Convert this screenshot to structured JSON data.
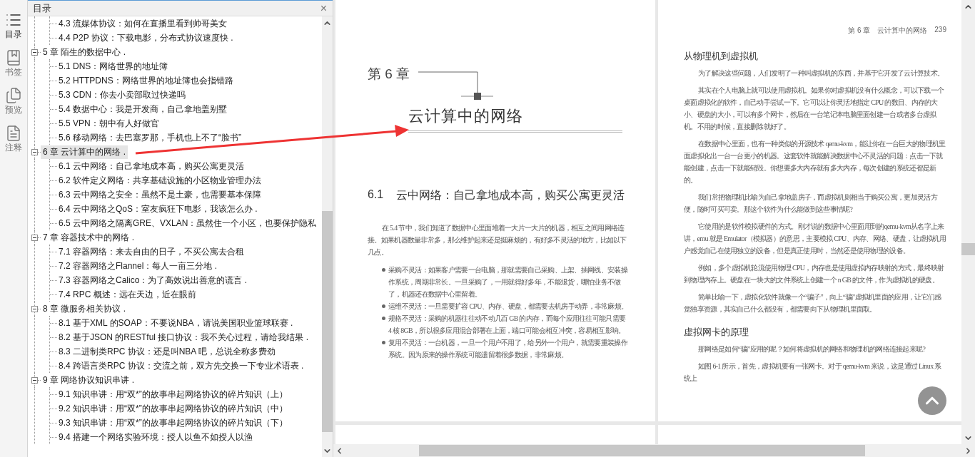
{
  "rail": [
    {
      "label": "目录",
      "selected": true
    },
    {
      "label": "书签",
      "selected": false
    },
    {
      "label": "预览",
      "selected": false
    },
    {
      "label": "注释",
      "selected": false
    }
  ],
  "toc": {
    "title": "目录",
    "close": "×",
    "tree": [
      {
        "children": [
          {
            "label": "4.3 流媒体协议：如何在直播里看到帅哥美女",
            "selected": false
          },
          {
            "label": "4.4 P2P 协议：下载电影，分布式协议速度快 .",
            "selected": false
          }
        ]
      },
      {
        "label": "5 章 陌生的数据中心 .",
        "expanded": true,
        "selected": false,
        "children": [
          {
            "label": "5.1 DNS：网络世界的地址簿",
            "selected": false
          },
          {
            "label": "5.2 HTTPDNS：网络世界的地址簿也会指错路",
            "selected": false
          },
          {
            "label": "5.3 CDN：你去小卖部取过快递吗",
            "selected": false
          },
          {
            "label": "5.4 数据中心：我是开发商，自己拿地盖别墅",
            "selected": false
          },
          {
            "label": "5.5 VPN：朝中有人好做官",
            "selected": false
          },
          {
            "label": "5.6 移动网络：去巴塞罗那，手机也上不了“脸书”",
            "selected": false
          }
        ]
      },
      {
        "label": "6 章 云计算中的网络 .",
        "expanded": true,
        "selected": true,
        "children": [
          {
            "label": "6.1 云中网络：自己拿地成本高，购买公寓更灵活",
            "selected": false
          },
          {
            "label": "6.2 软件定义网络：共享基础设施的小区物业管理办法",
            "selected": false
          },
          {
            "label": "6.3 云中网络之安全：虽然不是土豪，也需要基本保障",
            "selected": false
          },
          {
            "label": "6.4 云中网络之QoS：室友疯狂下电影，我该怎么办 .",
            "selected": false
          },
          {
            "label": "6.5 云中网络之隔离GRE、VXLAN：虽然住一个小区，也要保护隐私",
            "selected": false
          }
        ]
      },
      {
        "label": "7 章 容器技术中的网络 .",
        "expanded": true,
        "selected": false,
        "children": [
          {
            "label": "7.1 容器网络：来去自由的日子，不买公寓去合租",
            "selected": false
          },
          {
            "label": "7.2 容器网络之Flannel：每人一亩三分地 .",
            "selected": false
          },
          {
            "label": "7.3 容器网络之Calico：为了高效说出善意的谎言 .",
            "selected": false
          },
          {
            "label": "7.4 RPC 概述：远在天边，近在眼前",
            "selected": false
          }
        ]
      },
      {
        "label": "8 章 微服务相关协议 .",
        "expanded": true,
        "selected": false,
        "children": [
          {
            "label": "8.1 基于XML 的SOAP：不要说NBA，请说美国职业篮球联赛 .",
            "selected": false
          },
          {
            "label": "8.2 基于JSON 的RESTful 接口协议：我不关心过程，请给我结果 .",
            "selected": false
          },
          {
            "label": "8.3 二进制类RPC 协议：还是叫NBA 吧，总说全称多费劲",
            "selected": false
          },
          {
            "label": "8.4 跨语言类RPC 协议：交流之前，双方先交换一下专业术语表 .",
            "selected": false
          }
        ]
      },
      {
        "label": "9 章 网络协议知识串讲 .",
        "expanded": true,
        "selected": false,
        "children": [
          {
            "label": "9.1 知识串讲：用“双*”的故事串起网络协议的碎片知识（上）",
            "selected": false
          },
          {
            "label": "9.2 知识串讲：用“双*”的故事串起网络协议的碎片知识（中）",
            "selected": false
          },
          {
            "label": "9.3 知识串讲：用“双*”的故事串起网络协议的碎片知识（下）",
            "selected": false
          },
          {
            "label": "9.4 搭建一个网络实验环境：授人以鱼不如授人以渔",
            "selected": false
          }
        ]
      }
    ]
  },
  "left_page": {
    "chapter_label": "第 6 章",
    "chapter_title": "云计算中的网络",
    "section_number": "6.1",
    "section_title": "云中网络：自己拿地成本高，购买公寓更灵活",
    "intro": "在 5.4 节中，我们知道了数据中心里面堆着一大片一大片的机器，相互之间用网络连接。如果机器数量非常多，那么维护起来还是挺麻烦的，有好多不灵活的地方，比如以下几点。",
    "bullets": [
      "采购不灵活：如果客户需要一台电脑，那就需要自己采购、上架、插网线、安装操作系统，周期非常长。一旦采购了，一用就得好多年，不能退货，哪怕业务不做了，机器还在数据中心里留着。",
      "运维不灵活：一旦需要扩容 CPU、内存、硬盘，都需要去机房手动弄，非常麻烦。",
      "规格不灵活：采购的机器往往动不动几百 GB 的内存，而每个应用往往可能只需要 4 核 8GB，所以很多应用混合部署在上面，端口可能会相互冲突，容易相互影响。",
      "复用不灵活：一台机器，一旦一个用户不用了，给另外一个用户，就需要重装操作系统。因为原来的操作系统可能遗留着很多数据，非常麻烦。"
    ]
  },
  "right_page": {
    "running_head": "第 6 章　云计算中的网络",
    "page_number": "239",
    "blocks": [
      {
        "kind": "heading",
        "text": "从物理机到虚拟机"
      },
      {
        "kind": "paragraph",
        "text": "为了解决这些问题，人们发明了一种叫虚拟机的东西，并基于它开发了云计算技术。"
      },
      {
        "kind": "paragraph",
        "text": "其实在个人电脑上就可以使用虚拟机。如果你对虚拟机没有什么概念，可以下载一个桌面虚拟化的软件，自己动手尝试一下。它可以让你灵活地指定 CPU 的数目、内存的大小、硬盘的大小，可以有多个网卡，然后在一台笔记本电脑里面创建一台或者多台虚拟机。不用的时候，直接删除就好了。"
      },
      {
        "kind": "paragraph",
        "text": "在数据中心里面，也有一种类似的开源技术 qemu-kvm，能让你在一台巨大的物理机里面虚拟化出一台一台更小的机器。这套软件就能解决数据中心不灵活的问题：点击一下就能创建，点击一下就能销毁。你想要多大内存就有多大内存，每次创建的系统还都是新的。"
      },
      {
        "kind": "paragraph",
        "text": "我们常把物理机比喻为自己拿地盖房子，而虚拟机则相当于购买公寓，更加灵活方便，随时可买可卖。那这个软件为什么能做到这些事情呢?"
      },
      {
        "kind": "paragraph",
        "text": "它使用的是软件模拟硬件的方式。刚才说的数据中心里面用到的qemu-kvm从名字上来讲，emu 就是 Emulator（模拟器）的意思，主要模拟 CPU、内存、网络、硬盘，让虚拟机用户感觉自己在使用独立的设备，但是真正使用时，当然还是使用物理的设备。"
      },
      {
        "kind": "paragraph",
        "text": "例如，多个虚拟机轮流使用物理 CPU，内存也是使用虚拟内存映射的方式，最终映射到物理内存上。硬盘在一块大的文件系统上创建一个 n GB 的文件，作为虚拟机的硬盘。"
      },
      {
        "kind": "paragraph",
        "text": "简单比喻一下，虚拟化软件就像一个“骗子”，向上“骗”虚拟机里面的应用，让它们感觉独享资源，其实自己什么都没有，都需要向下从物理机里面取。"
      },
      {
        "kind": "heading",
        "text": "虚拟网卡的原理"
      },
      {
        "kind": "paragraph",
        "text": "那网络是如何“骗”应用的呢？如何将虚拟机的网络和物理机的网络连接起来呢?"
      },
      {
        "kind": "paragraph",
        "text": "如图 6-1 所示，首先，虚拟机要有一张网卡。对于 qemu-kvm 来说，这是通过 Linux 系统上"
      }
    ]
  }
}
